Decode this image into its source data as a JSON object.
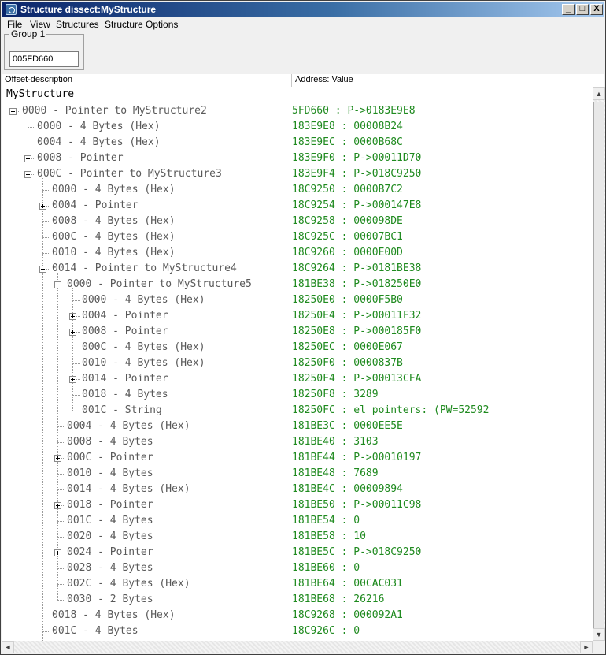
{
  "window": {
    "title": "Structure dissect:MyStructure",
    "controls": [
      "_",
      "□",
      "X"
    ]
  },
  "menu": {
    "items": [
      "File",
      "View",
      "Structures",
      "Structure Options"
    ]
  },
  "group": {
    "label": "Group 1",
    "address": "005FD660"
  },
  "columns": {
    "offset": "Offset-description",
    "address": "Address: Value"
  },
  "tree": {
    "root": "MyStructure",
    "rows": [
      {
        "desc": "0000 - Pointer to MyStructure2",
        "val": "5FD660 : P->0183E9E8",
        "level": 0,
        "exp": "minus"
      },
      {
        "desc": "0000 - 4 Bytes (Hex)",
        "val": "183E9E8 : 00008B24",
        "level": 1,
        "exp": ""
      },
      {
        "desc": "0004 - 4 Bytes (Hex)",
        "val": "183E9EC : 0000B68C",
        "level": 1,
        "exp": ""
      },
      {
        "desc": "0008 - Pointer",
        "val": "183E9F0 : P->00011D70",
        "level": 1,
        "exp": "plus"
      },
      {
        "desc": "000C - Pointer to MyStructure3",
        "val": "183E9F4 : P->018C9250",
        "level": 1,
        "exp": "minus"
      },
      {
        "desc": "0000 - 4 Bytes (Hex)",
        "val": "18C9250 : 0000B7C2",
        "level": 2,
        "exp": ""
      },
      {
        "desc": "0004 - Pointer",
        "val": "18C9254 : P->000147E8",
        "level": 2,
        "exp": "plus"
      },
      {
        "desc": "0008 - 4 Bytes (Hex)",
        "val": "18C9258 : 000098DE",
        "level": 2,
        "exp": ""
      },
      {
        "desc": "000C - 4 Bytes (Hex)",
        "val": "18C925C : 00007BC1",
        "level": 2,
        "exp": ""
      },
      {
        "desc": "0010 - 4 Bytes (Hex)",
        "val": "18C9260 : 0000E00D",
        "level": 2,
        "exp": ""
      },
      {
        "desc": "0014 - Pointer to MyStructure4",
        "val": "18C9264 : P->0181BE38",
        "level": 2,
        "exp": "minus"
      },
      {
        "desc": "0000 - Pointer to MyStructure5",
        "val": "181BE38 : P->018250E0",
        "level": 3,
        "exp": "minus"
      },
      {
        "desc": "0000 - 4 Bytes (Hex)",
        "val": "18250E0 : 0000F5B0",
        "level": 4,
        "exp": ""
      },
      {
        "desc": "0004 - Pointer",
        "val": "18250E4 : P->00011F32",
        "level": 4,
        "exp": "plus"
      },
      {
        "desc": "0008 - Pointer",
        "val": "18250E8 : P->000185F0",
        "level": 4,
        "exp": "plus"
      },
      {
        "desc": "000C - 4 Bytes (Hex)",
        "val": "18250EC : 0000E067",
        "level": 4,
        "exp": ""
      },
      {
        "desc": "0010 - 4 Bytes (Hex)",
        "val": "18250F0 : 0000837B",
        "level": 4,
        "exp": ""
      },
      {
        "desc": "0014 - Pointer",
        "val": "18250F4 : P->00013CFA",
        "level": 4,
        "exp": "plus"
      },
      {
        "desc": "0018 - 4 Bytes",
        "val": "18250F8 : 3289",
        "level": 4,
        "exp": ""
      },
      {
        "desc": "001C - String",
        "val": "18250FC : el pointers: (PW=52592",
        "level": 4,
        "exp": ""
      },
      {
        "desc": "0004 - 4 Bytes (Hex)",
        "val": "181BE3C : 0000EE5E",
        "level": 3,
        "exp": ""
      },
      {
        "desc": "0008 - 4 Bytes",
        "val": "181BE40 : 3103",
        "level": 3,
        "exp": ""
      },
      {
        "desc": "000C - Pointer",
        "val": "181BE44 : P->00010197",
        "level": 3,
        "exp": "plus"
      },
      {
        "desc": "0010 - 4 Bytes",
        "val": "181BE48 : 7689",
        "level": 3,
        "exp": ""
      },
      {
        "desc": "0014 - 4 Bytes (Hex)",
        "val": "181BE4C : 00009894",
        "level": 3,
        "exp": ""
      },
      {
        "desc": "0018 - Pointer",
        "val": "181BE50 : P->00011C98",
        "level": 3,
        "exp": "plus"
      },
      {
        "desc": "001C - 4 Bytes",
        "val": "181BE54 : 0",
        "level": 3,
        "exp": ""
      },
      {
        "desc": "0020 - 4 Bytes",
        "val": "181BE58 : 10",
        "level": 3,
        "exp": ""
      },
      {
        "desc": "0024 - Pointer",
        "val": "181BE5C : P->018C9250",
        "level": 3,
        "exp": "plus"
      },
      {
        "desc": "0028 - 4 Bytes",
        "val": "181BE60 : 0",
        "level": 3,
        "exp": ""
      },
      {
        "desc": "002C - 4 Bytes (Hex)",
        "val": "181BE64 : 00CAC031",
        "level": 3,
        "exp": ""
      },
      {
        "desc": "0030 - 2 Bytes",
        "val": "181BE68 : 26216",
        "level": 3,
        "exp": ""
      },
      {
        "desc": "0018 - 4 Bytes (Hex)",
        "val": "18C9268 : 000092A1",
        "level": 2,
        "exp": ""
      },
      {
        "desc": "001C - 4 Bytes",
        "val": "18C926C : 0",
        "level": 2,
        "exp": ""
      }
    ]
  },
  "scrollbar": {
    "up": "▲",
    "down": "▼",
    "left": "◄",
    "right": "►"
  },
  "colors": {
    "value": "#1f8a1f",
    "desc": "#595959",
    "title_start": "#0a246a",
    "title_end": "#a6caf0"
  }
}
